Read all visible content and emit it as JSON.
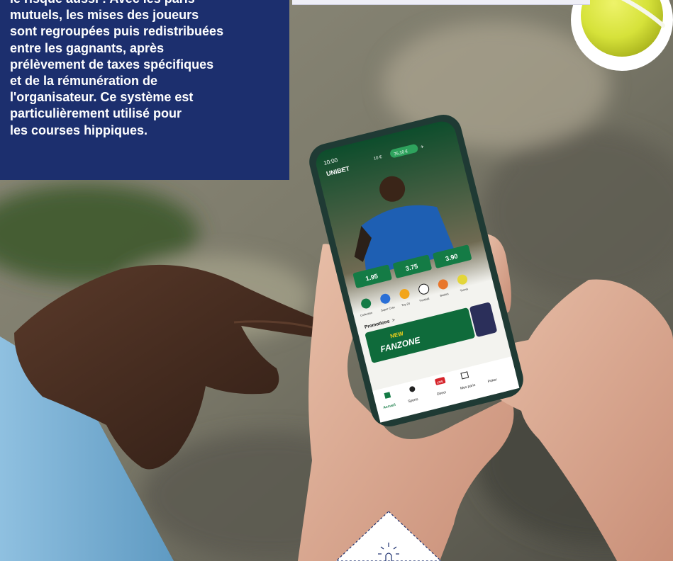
{
  "article": {
    "paragraph_lines": [
      "le risque aussi : Avec les paris",
      "mutuels, les mises des joueurs",
      "sont regroupées puis redistribuées",
      "entre les gagnants, après",
      "prélèvement de taxes spécifiques",
      "et de la rémunération de",
      "l'organisateur. Ce système est",
      "particulièrement utilisé pour",
      "les courses hippiques."
    ]
  },
  "phone_app": {
    "status_time": "10:00",
    "brand": "UNIBET",
    "balance_chip": "10 €",
    "balance_green": "75,10 €",
    "balance_plus": "+",
    "odds": [
      "1.95",
      "3.75",
      "3.90"
    ],
    "sports_icons": [
      {
        "label": "Collection",
        "icon": "collection-icon"
      },
      {
        "label": "Super Cote",
        "icon": "super-cote-icon"
      },
      {
        "label": "Top 20",
        "icon": "top-icon"
      },
      {
        "label": "Football",
        "icon": "football-icon"
      },
      {
        "label": "Basket",
        "icon": "basketball-icon"
      },
      {
        "label": "Tennis",
        "icon": "tennis-icon"
      }
    ],
    "promotions_label": "Promotions",
    "promotions_chevron": ">",
    "banner_new": "NEW",
    "banner_title": "FANZONE",
    "bottom_nav": [
      {
        "label": "Accueil",
        "icon": "home-icon"
      },
      {
        "label": "Sports",
        "icon": "sports-icon"
      },
      {
        "label": "Direct",
        "icon": "live-icon",
        "badge": "LIVE"
      },
      {
        "label": "Mes paris",
        "icon": "bets-icon"
      },
      {
        "label": "Poker",
        "icon": "poker-icon"
      }
    ]
  },
  "colors": {
    "card_bg": "#1c2f6e",
    "card_text": "#ffffff",
    "unibet_green": "#147b45",
    "tennis_ball": "#d6e23a",
    "background_blur": "#7c7a6a"
  }
}
